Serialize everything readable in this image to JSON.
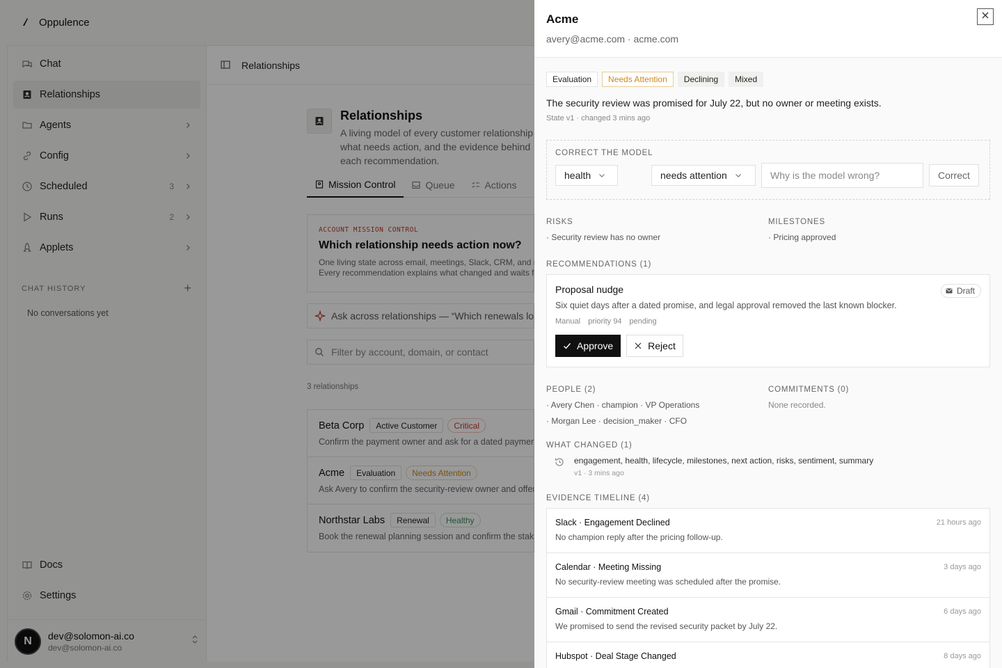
{
  "app": {
    "brand": "Oppulence",
    "nav": [
      {
        "label": "Chat",
        "icon": "chat-icon",
        "count": "",
        "chevron": false,
        "active": false
      },
      {
        "label": "Relationships",
        "icon": "contact-book-icon",
        "count": "",
        "chevron": false,
        "active": true
      },
      {
        "label": "Agents",
        "icon": "folder-icon",
        "count": "",
        "chevron": true,
        "active": false
      },
      {
        "label": "Config",
        "icon": "link-icon",
        "count": "",
        "chevron": true,
        "active": false
      },
      {
        "label": "Scheduled",
        "icon": "clock-icon",
        "count": "3",
        "chevron": true,
        "active": false
      },
      {
        "label": "Runs",
        "icon": "play-icon",
        "count": "2",
        "chevron": true,
        "active": false
      },
      {
        "label": "Applets",
        "icon": "rocket-icon",
        "count": "",
        "chevron": true,
        "active": false
      }
    ],
    "chat_history": {
      "label": "CHAT HISTORY",
      "empty": "No conversations yet"
    },
    "bottom_nav": [
      {
        "label": "Docs",
        "icon": "book-icon"
      },
      {
        "label": "Settings",
        "icon": "gear-icon"
      }
    ],
    "user": {
      "initial": "N",
      "name": "dev@solomon-ai.co",
      "email": "dev@solomon-ai.co"
    },
    "header_title": "Relationships",
    "page": {
      "title": "Relationships",
      "description": "A living model of every customer relationship — what needs action, and the evidence behind each recommendation."
    },
    "tabs": [
      {
        "label": "Mission Control",
        "active": true
      },
      {
        "label": "Queue",
        "active": false
      },
      {
        "label": "Actions",
        "active": false
      }
    ],
    "mission": {
      "kicker": "ACCOUNT MISSION CONTROL",
      "title": "Which relationship needs action now?",
      "line1": "One living state across email, meetings, Slack, CRM, and more.",
      "line2": "Every recommendation explains what changed and waits for approval."
    },
    "ask_text": "Ask across relationships — “Which renewals look at risk?”",
    "filter_placeholder": "Filter by account, domain, or contact",
    "rel_count": "3 relationships",
    "relationships": [
      {
        "name": "Beta Corp",
        "stage": "Active Customer",
        "health": "Critical",
        "health_class": "critical",
        "desc": "Confirm the payment owner and ask for a dated payment plan."
      },
      {
        "name": "Acme",
        "stage": "Evaluation",
        "health": "Needs Attention",
        "health_class": "attn",
        "desc": "Ask Avery to confirm the security-review owner and offer times."
      },
      {
        "name": "Northstar Labs",
        "stage": "Renewal",
        "health": "Healthy",
        "health_class": "healthy",
        "desc": "Book the renewal planning session and confirm the stakeholders."
      }
    ]
  },
  "panel": {
    "title": "Acme",
    "subtitle": "avery@acme.com · acme.com",
    "tags": [
      {
        "label": "Evaluation",
        "style": "outline"
      },
      {
        "label": "Needs Attention",
        "style": "attn"
      },
      {
        "label": "Declining",
        "style": "soft"
      },
      {
        "label": "Mixed",
        "style": "soft"
      }
    ],
    "summary": "The security review was promised for July 22, but no owner or meeting exists.",
    "state_line": "State v1 · changed 3 mins ago",
    "correct": {
      "label": "CORRECT THE MODEL",
      "field_value": "health",
      "new_value": "needs attention",
      "reason_placeholder": "Why is the model wrong?",
      "button": "Correct"
    },
    "risks": {
      "label": "RISKS",
      "items": [
        "· Security review has no owner"
      ]
    },
    "milestones": {
      "label": "MILESTONES",
      "items": [
        "· Pricing approved"
      ]
    },
    "recommendations": {
      "label": "RECOMMENDATIONS (1)",
      "items": [
        {
          "title": "Proposal nudge",
          "badge": "Draft",
          "desc": "Six quiet days after a dated promise, and legal approval removed the last known blocker.",
          "source": "Manual",
          "priority": "priority 94",
          "status": "pending",
          "approve": "Approve",
          "reject": "Reject"
        }
      ]
    },
    "people": {
      "label": "PEOPLE (2)",
      "items": [
        "· Avery Chen · champion · VP Operations",
        "· Morgan Lee · decision_maker · CFO"
      ]
    },
    "commitments": {
      "label": "COMMITMENTS (0)",
      "empty": "None recorded."
    },
    "what_changed": {
      "label": "WHAT CHANGED (1)",
      "items": [
        {
          "text": "engagement, health, lifecycle, milestones, next action, risks, sentiment, summary",
          "sub": "v1 · 3 mins ago"
        }
      ]
    },
    "timeline": {
      "label": "EVIDENCE TIMELINE (4)",
      "items": [
        {
          "title": "Slack · Engagement Declined",
          "time": "21 hours ago",
          "desc": "No champion reply after the pricing follow-up."
        },
        {
          "title": "Calendar · Meeting Missing",
          "time": "3 days ago",
          "desc": "No security-review meeting was scheduled after the promise."
        },
        {
          "title": "Gmail · Commitment Created",
          "time": "6 days ago",
          "desc": "We promised to send the revised security packet by July 22."
        },
        {
          "title": "Hubspot · Deal Stage Changed",
          "time": "8 days ago",
          "desc": ""
        }
      ]
    }
  }
}
